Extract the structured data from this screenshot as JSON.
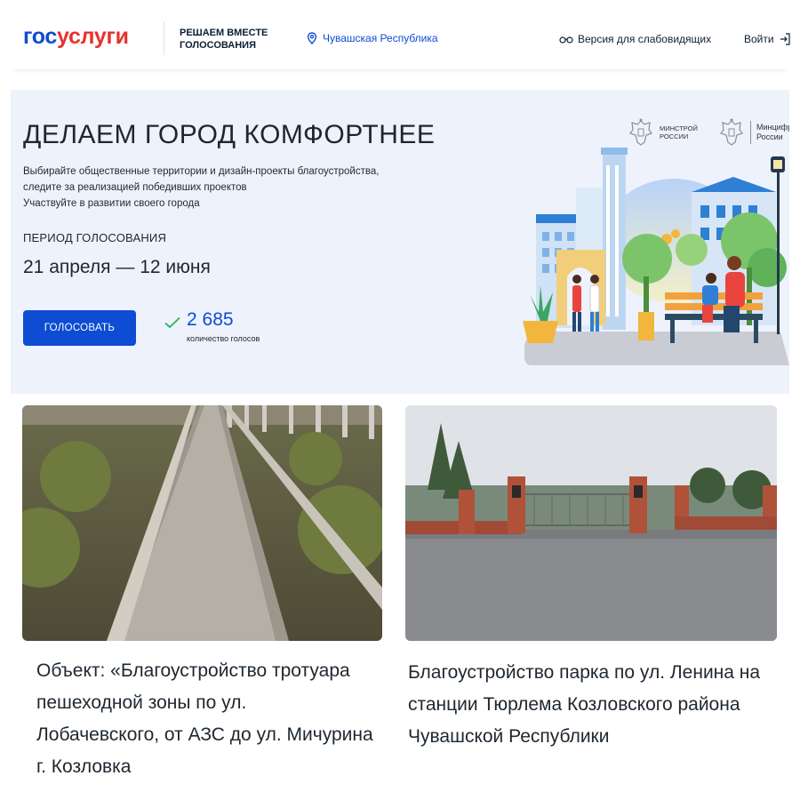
{
  "header": {
    "logo_part1": "гос",
    "logo_part2": "услуги",
    "tagline": "РЕШАЕМ ВМЕСТЕ ГОЛОСОВАНИЯ",
    "region": "Чувашская Республика",
    "low_vision": "Версия для слабовидящих",
    "login": "Войти",
    "icons": [
      "location-pin-icon",
      "glasses-icon",
      "login-arrow-icon"
    ]
  },
  "hero": {
    "title": "ДЕЛАЕМ ГОРОД КОМФОРТНЕЕ",
    "description": [
      "Выбирайте общественные территории и дизайн-проекты благоустройства,",
      "следите за реализацией победивших проектов",
      "Участвуйте в развитии своего города"
    ],
    "period_label": "ПЕРИОД ГОЛОСОВАНИЯ",
    "period_dates": "21 апреля — 12 июня",
    "vote_button": "ГОЛОСОВАТЬ",
    "votes_count": "2 685",
    "votes_label": "количество голосов",
    "ministry1": [
      "МИНСТРОЙ",
      "РОССИИ"
    ],
    "ministry2": [
      "Минцифры",
      "России"
    ]
  },
  "cards": [
    {
      "title": "Объект: «Благоустройство тротуара пешеходной зоны по ул. Лобачевского, от АЗС до ул. Мичурина г. Козловка",
      "image": "sidewalk-photo"
    },
    {
      "title": "Благоустройство парка по ул. Ленина на станции Тюрлема Козловского района Чувашской Республики",
      "image": "park-gate-photo"
    }
  ],
  "colors": {
    "brand_blue": "#0d4cd3",
    "brand_red": "#e8312f",
    "hero_bg": "#eef2fd",
    "check_green": "#2fb34a"
  }
}
